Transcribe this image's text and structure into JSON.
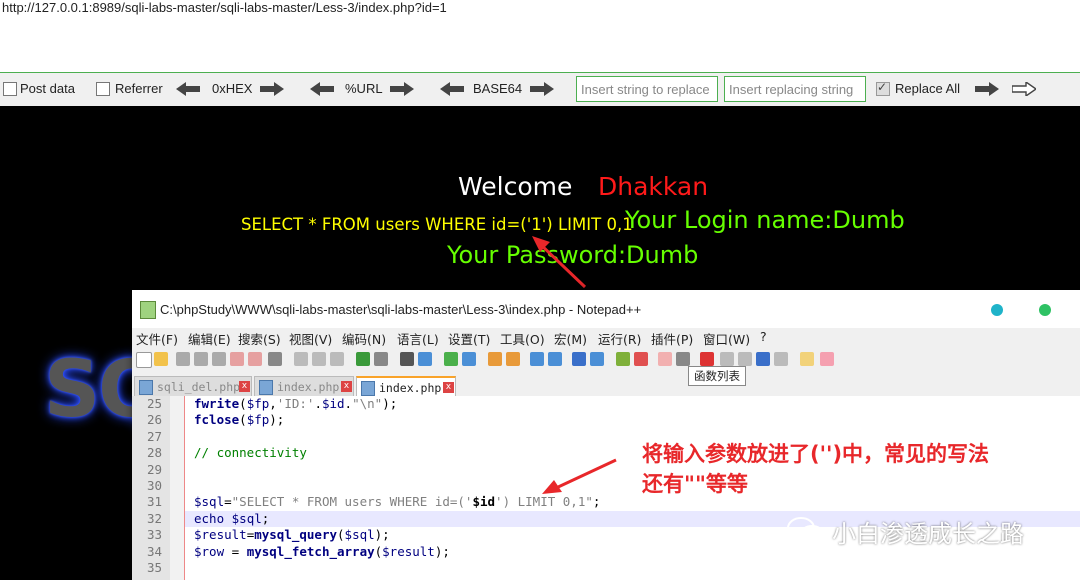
{
  "browser": {
    "url": "http://127.0.0.1:8989/sqli-labs-master/sqli-labs-master/Less-3/index.php?id=1"
  },
  "hackbar": {
    "post_data_label": "Post data",
    "referrer_label": "Referrer",
    "hex_label": "0xHEX",
    "url_label": "%URL",
    "base64_label": "BASE64",
    "insert_string_placeholder": "Insert string to replace",
    "insert_replacing_placeholder": "Insert replacing string",
    "replace_all_label": "Replace All",
    "replace_all_checked": true
  },
  "page": {
    "welcome": "Welcome",
    "name": "Dhakkan",
    "query": "SELECT * FROM users WHERE id=('1') LIMIT 0,1",
    "login_name": "Your Login name:Dumb",
    "password": "Your Password:Dumb",
    "logo_text": "SQ",
    "colors": {
      "welcome": "#ffffff",
      "name": "#ff0000",
      "query": "#ffff00",
      "result": "#66ff00"
    }
  },
  "notepad": {
    "title": "C:\\phpStudy\\WWW\\sqli-labs-master\\sqli-labs-master\\Less-3\\index.php - Notepad++",
    "menu": [
      "文件(F)",
      "编辑(E)",
      "搜索(S)",
      "视图(V)",
      "编码(N)",
      "语言(L)",
      "设置(T)",
      "工具(O)",
      "宏(M)",
      "运行(R)",
      "插件(P)",
      "窗口(W)",
      "?"
    ],
    "tooltip": "函数列表",
    "tabs": [
      {
        "label": "sqli_del.php",
        "active": false
      },
      {
        "label": "index.php",
        "active": false
      },
      {
        "label": "index.php",
        "active": true
      }
    ],
    "lines": [
      {
        "num": "25",
        "code": "fwrite($fp,'ID:'.$id.\"\\n\");"
      },
      {
        "num": "26",
        "code": "fclose($fp);"
      },
      {
        "num": "27",
        "code": ""
      },
      {
        "num": "28",
        "code": "// connectivity"
      },
      {
        "num": "29",
        "code": ""
      },
      {
        "num": "30",
        "code": ""
      },
      {
        "num": "31",
        "code": "$sql=\"SELECT * FROM users WHERE id=('$id') LIMIT 0,1\";"
      },
      {
        "num": "32",
        "code": "echo $sql;"
      },
      {
        "num": "33",
        "code": "$result=mysql_query($sql);"
      },
      {
        "num": "34",
        "code": "$row = mysql_fetch_array($result);"
      },
      {
        "num": "35",
        "code": ""
      }
    ]
  },
  "annotation": {
    "line1": "将输入参数放进了('')中，常见的写法",
    "line2": "还有\"\"等等"
  },
  "watermark": "小白渗透成长之路"
}
